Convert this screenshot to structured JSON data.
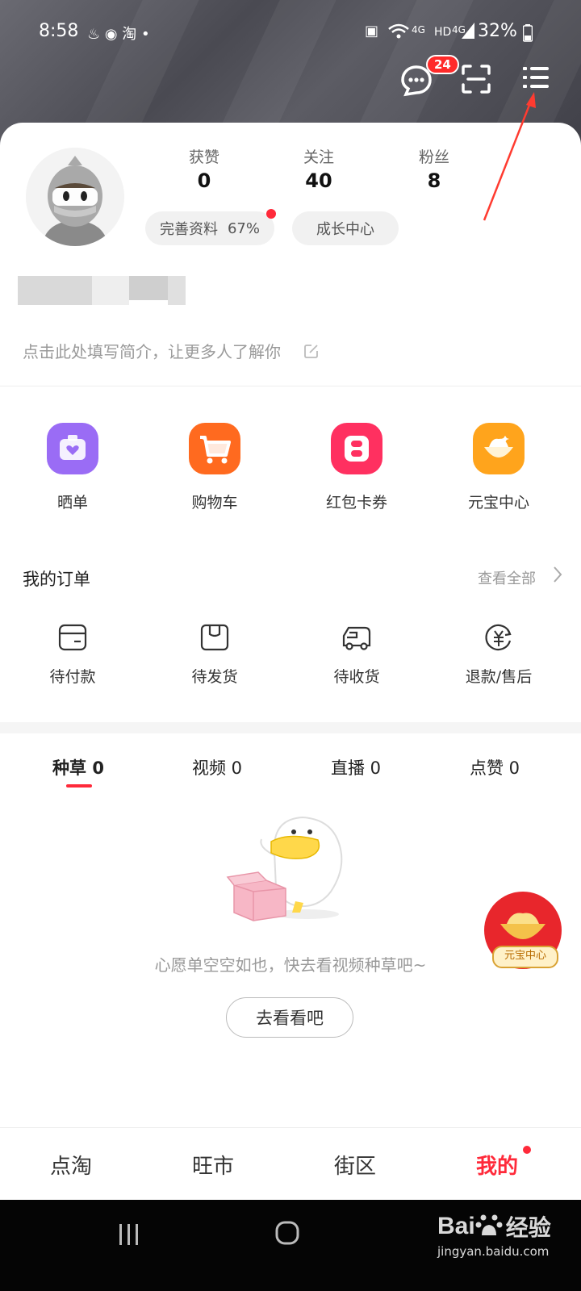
{
  "status_bar": {
    "time": "8:58",
    "battery": "32%",
    "network": "4G",
    "hd": "HD"
  },
  "header": {
    "message_badge": "24"
  },
  "profile": {
    "stats": [
      {
        "label": "获赞",
        "value": "0"
      },
      {
        "label": "关注",
        "value": "40"
      },
      {
        "label": "粉丝",
        "value": "8"
      }
    ],
    "complete_profile": "完善资料",
    "complete_percent": "67%",
    "growth_center": "成长中心",
    "bio_placeholder": "点击此处填写简介，让更多人了解你"
  },
  "quick_entries": [
    {
      "label": "晒单",
      "icon": "camera-heart-icon",
      "color": "#9a6cf5"
    },
    {
      "label": "购物车",
      "icon": "cart-icon",
      "color": "#ff6a1f"
    },
    {
      "label": "红包卡券",
      "icon": "coupon-icon",
      "color": "#ff3060"
    },
    {
      "label": "元宝中心",
      "icon": "ingot-icon",
      "color": "#ffa41c"
    }
  ],
  "orders": {
    "title": "我的订单",
    "see_all": "查看全部",
    "items": [
      {
        "label": "待付款",
        "icon": "wallet-icon"
      },
      {
        "label": "待发货",
        "icon": "package-icon"
      },
      {
        "label": "待收货",
        "icon": "truck-icon"
      },
      {
        "label": "退款/售后",
        "icon": "refund-icon"
      }
    ]
  },
  "content_tabs": [
    {
      "label": "种草",
      "count": "0"
    },
    {
      "label": "视频",
      "count": "0"
    },
    {
      "label": "直播",
      "count": "0"
    },
    {
      "label": "点赞",
      "count": "0"
    }
  ],
  "empty_state": {
    "message": "心愿单空空如也，快去看视频种草吧~",
    "button": "去看看吧"
  },
  "floating": {
    "label": "元宝中心"
  },
  "bottom_nav": [
    {
      "label": "点淘"
    },
    {
      "label": "旺市"
    },
    {
      "label": "街区"
    },
    {
      "label": "我的"
    }
  ],
  "watermark": {
    "brand": "Bai",
    "brand2": "经验",
    "url": "jingyan.baidu.com"
  },
  "colors": {
    "accent": "#ff2a3a",
    "annotation_arrow": "#ff3b30"
  }
}
